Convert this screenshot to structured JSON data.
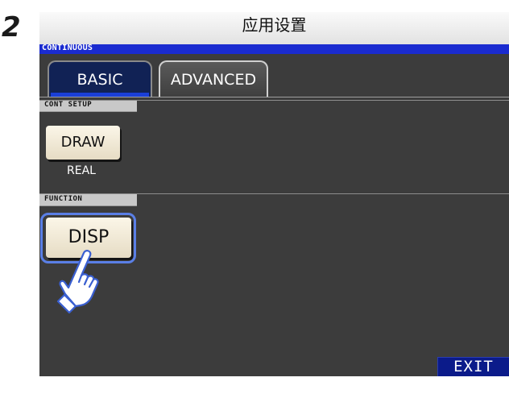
{
  "step": {
    "number": "2"
  },
  "screen": {
    "title": "应用设置",
    "mode": "CONTINUOUS",
    "tabs": [
      {
        "label": "BASIC",
        "selected": true
      },
      {
        "label": "ADVANCED",
        "selected": false
      }
    ],
    "sections": {
      "cont_setup": {
        "header": "CONT SETUP",
        "button_label": "DRAW",
        "value": "REAL"
      },
      "function": {
        "header": "FUNCTION",
        "button_label": "DISP"
      }
    },
    "exit_label": "EXIT"
  },
  "icons": {
    "pointer": "hand-pointer-icon"
  },
  "colors": {
    "screen_background": "#3c3c3c",
    "mode_bar": "#1a2bd0",
    "selected_tab": "#112255",
    "key_face": "#f3ecd8",
    "highlight_ring": "#5a7fe6",
    "exit_button": "#0b1b8a"
  }
}
